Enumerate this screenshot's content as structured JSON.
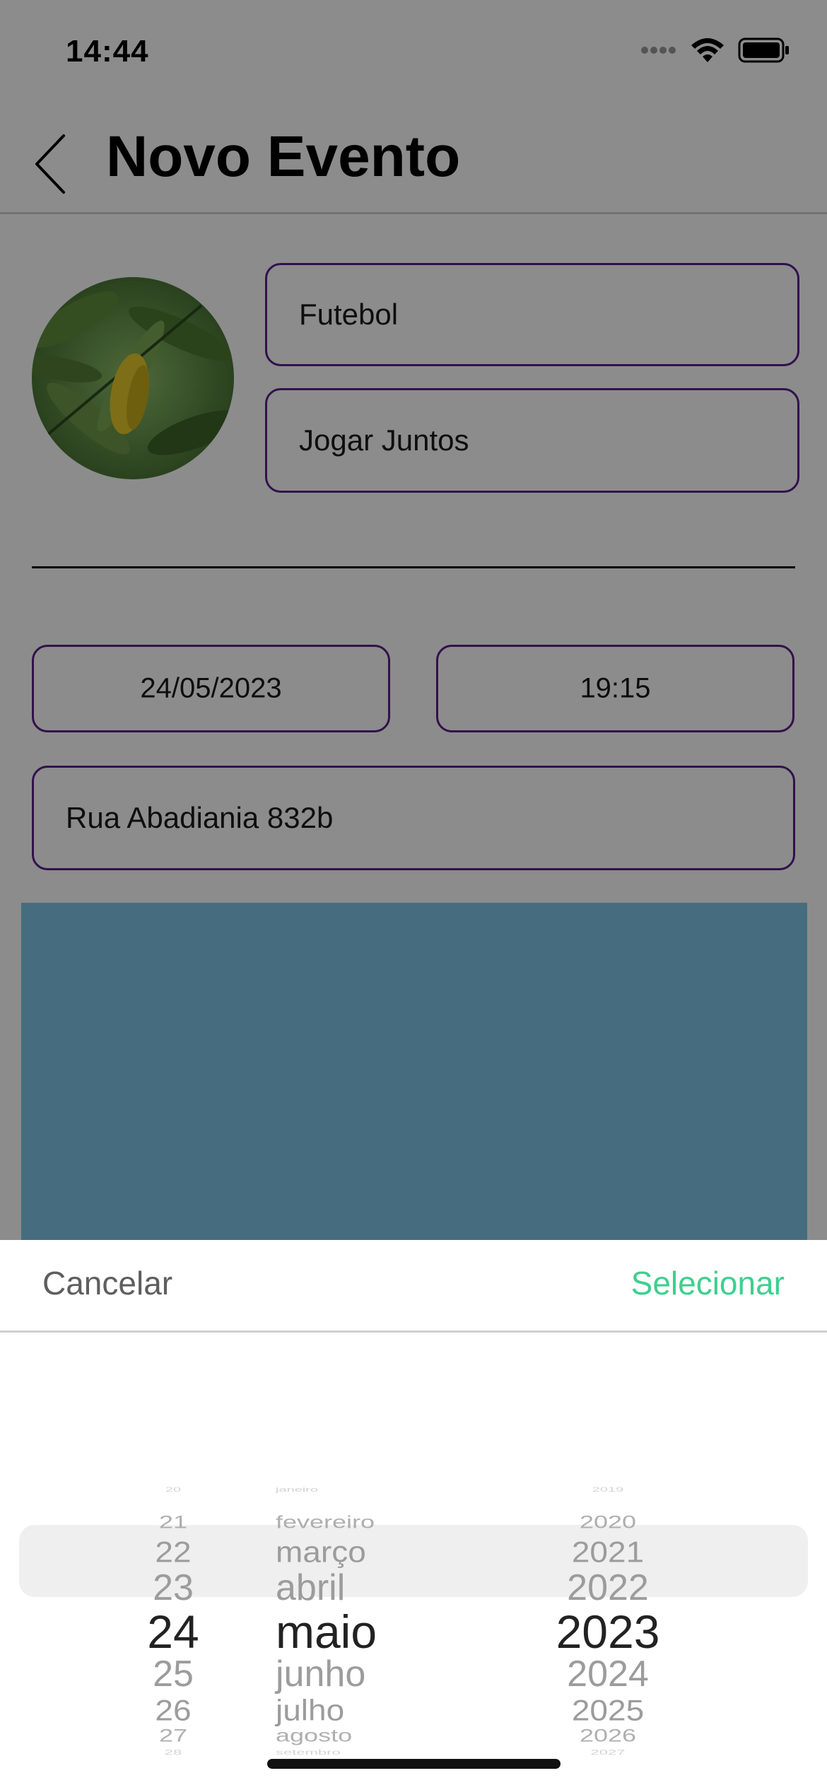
{
  "status_bar": {
    "time": "14:44"
  },
  "nav": {
    "title": "Novo Evento"
  },
  "form": {
    "name_value": "Futebol",
    "description_value": "Jogar Juntos",
    "date_value": "24/05/2023",
    "time_value": "19:15",
    "address_value": "Rua Abadiania 832b"
  },
  "sheet": {
    "cancel_label": "Cancelar",
    "select_label": "Selecionar",
    "days": [
      "20",
      "21",
      "22",
      "23",
      "24",
      "25",
      "26",
      "27",
      "28"
    ],
    "months": [
      "janeiro",
      "fevereiro",
      "março",
      "abril",
      "maio",
      "junho",
      "julho",
      "agosto",
      "setembro"
    ],
    "years": [
      "2019",
      "2020",
      "2021",
      "2022",
      "2023",
      "2024",
      "2025",
      "2026",
      "2027"
    ],
    "selected": {
      "day": "24",
      "month": "maio",
      "year": "2023"
    }
  },
  "colors": {
    "accent_green": "#3ecf8e",
    "field_border": "#5b1f8a",
    "map_blue": "#7fc7e8"
  }
}
